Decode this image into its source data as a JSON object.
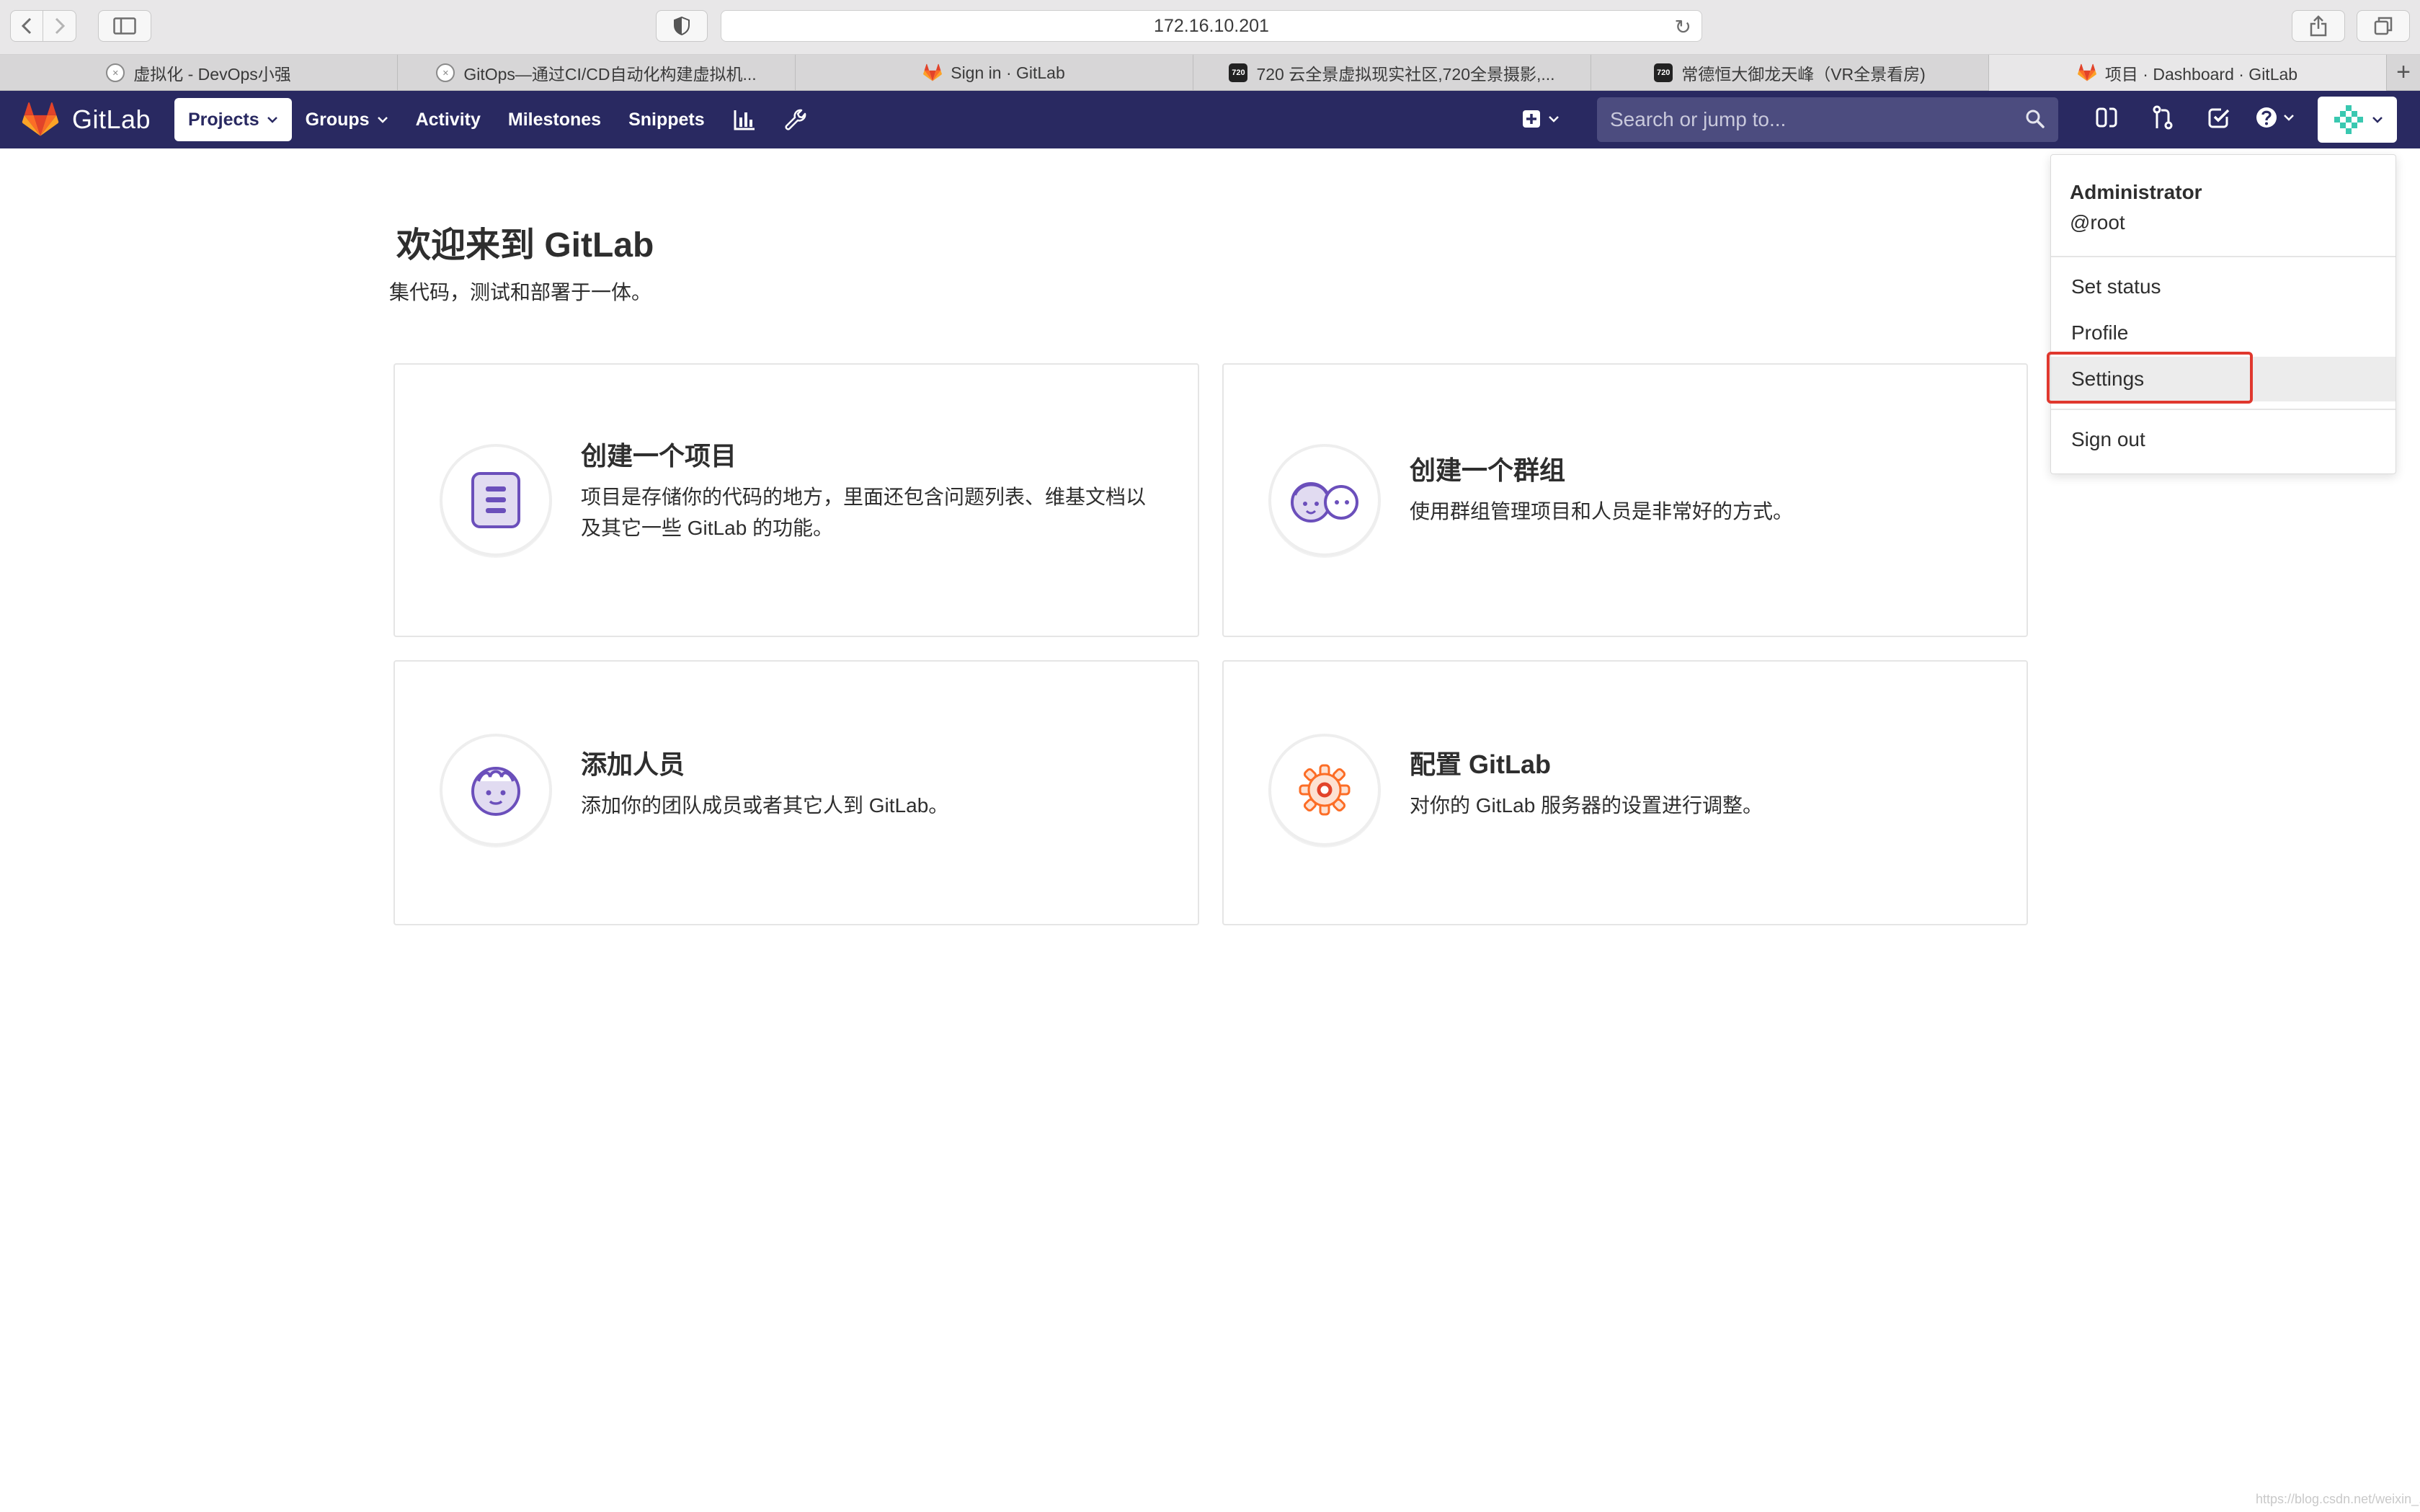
{
  "browser": {
    "url": "172.16.10.201",
    "tabs": [
      {
        "label": "虚拟化 - DevOps小强",
        "favicon": "circle"
      },
      {
        "label": "GitOps—通过CI/CD自动化构建虚拟机...",
        "favicon": "circle"
      },
      {
        "label": "Sign in · GitLab",
        "favicon": "gitlab"
      },
      {
        "label": "720 云全景虚拟现实社区,720全景摄影,...",
        "favicon": "720"
      },
      {
        "label": "常德恒大御龙天峰（VR全景看房)",
        "favicon": "720"
      },
      {
        "label": "项目 · Dashboard · GitLab",
        "favicon": "gitlab"
      }
    ],
    "new_tab": "+"
  },
  "navbar": {
    "brand": "GitLab",
    "links": {
      "projects": "Projects",
      "groups": "Groups",
      "activity": "Activity",
      "milestones": "Milestones",
      "snippets": "Snippets"
    },
    "search_placeholder": "Search or jump to..."
  },
  "main": {
    "title": "欢迎来到 GitLab",
    "subtitle": "集代码，测试和部署于一体。",
    "cards": [
      {
        "title": "创建一个项目",
        "desc": "项目是存储你的代码的地方，里面还包含问题列表、维基文档以及其它一些 GitLab 的功能。"
      },
      {
        "title": "创建一个群组",
        "desc": "使用群组管理项目和人员是非常好的方式。"
      },
      {
        "title": "添加人员",
        "desc": "添加你的团队成员或者其它人到 GitLab。"
      },
      {
        "title": "配置 GitLab",
        "desc": "对你的 GitLab 服务器的设置进行调整。"
      }
    ]
  },
  "user_menu": {
    "name": "Administrator",
    "handle": "@root",
    "items": {
      "set_status": "Set status",
      "profile": "Profile",
      "settings": "Settings",
      "sign_out": "Sign out"
    }
  },
  "colors": {
    "navbar": "#292961",
    "highlight": "#e0382e",
    "accent_purple": "#6b4fbb",
    "accent_orange": "#fc6d26"
  },
  "watermark": "https://blog.csdn.net/weixin_..."
}
